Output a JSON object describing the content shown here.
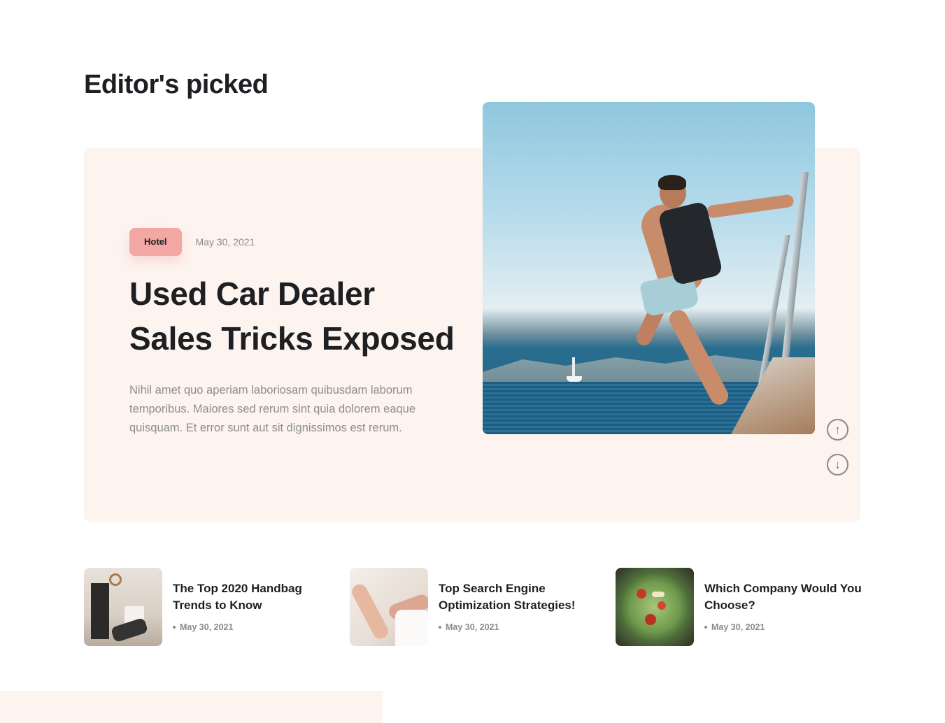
{
  "section": {
    "title": "Editor's picked"
  },
  "featured": {
    "tag": "Hotel",
    "date": "May 30, 2021",
    "title": "Used Car Dealer Sales Tricks Exposed",
    "excerpt": "Nihil amet quo aperiam laboriosam quibusdam laborum temporibus. Maiores sed rerum sint quia dolorem eaque quisquam. Et error sunt aut sit dignissimos est rerum.",
    "nav_up_icon": "arrow-up-circle-icon",
    "nav_down_icon": "arrow-down-circle-icon"
  },
  "posts": [
    {
      "title": "The Top 2020 Handbag Trends to Know",
      "date": "May 30, 2021"
    },
    {
      "title": "Top Search Engine Optimization Strategies!",
      "date": "May 30, 2021"
    },
    {
      "title": "Which Company Would You Choose?",
      "date": "May 30, 2021"
    }
  ],
  "colors": {
    "card_bg": "#fdf4ef",
    "tag_bg": "#f2a7a4",
    "text_dark": "#1d1f22",
    "text_muted": "#8d8d8d"
  }
}
